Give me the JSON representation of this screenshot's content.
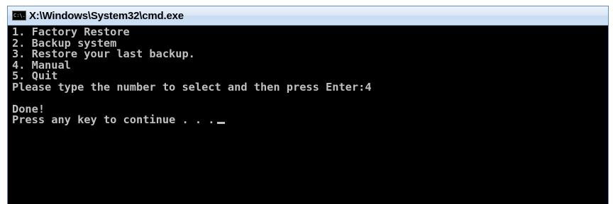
{
  "window": {
    "title": "X:\\Windows\\System32\\cmd.exe",
    "icon": "console-icon",
    "icon_text": "C:\\."
  },
  "console": {
    "menu": [
      "1. Factory Restore",
      "2. Backup system",
      "3. Restore your last backup.",
      "4. Manual",
      "5. Quit"
    ],
    "prompt": "Please type the number to select and then press Enter:4",
    "result": "Done!",
    "continue_prompt": "Press any key to continue . . ."
  },
  "colors": {
    "console_background": "#000000",
    "console_text": "#c0c0c0",
    "titlebar": "#dbe8f6"
  }
}
